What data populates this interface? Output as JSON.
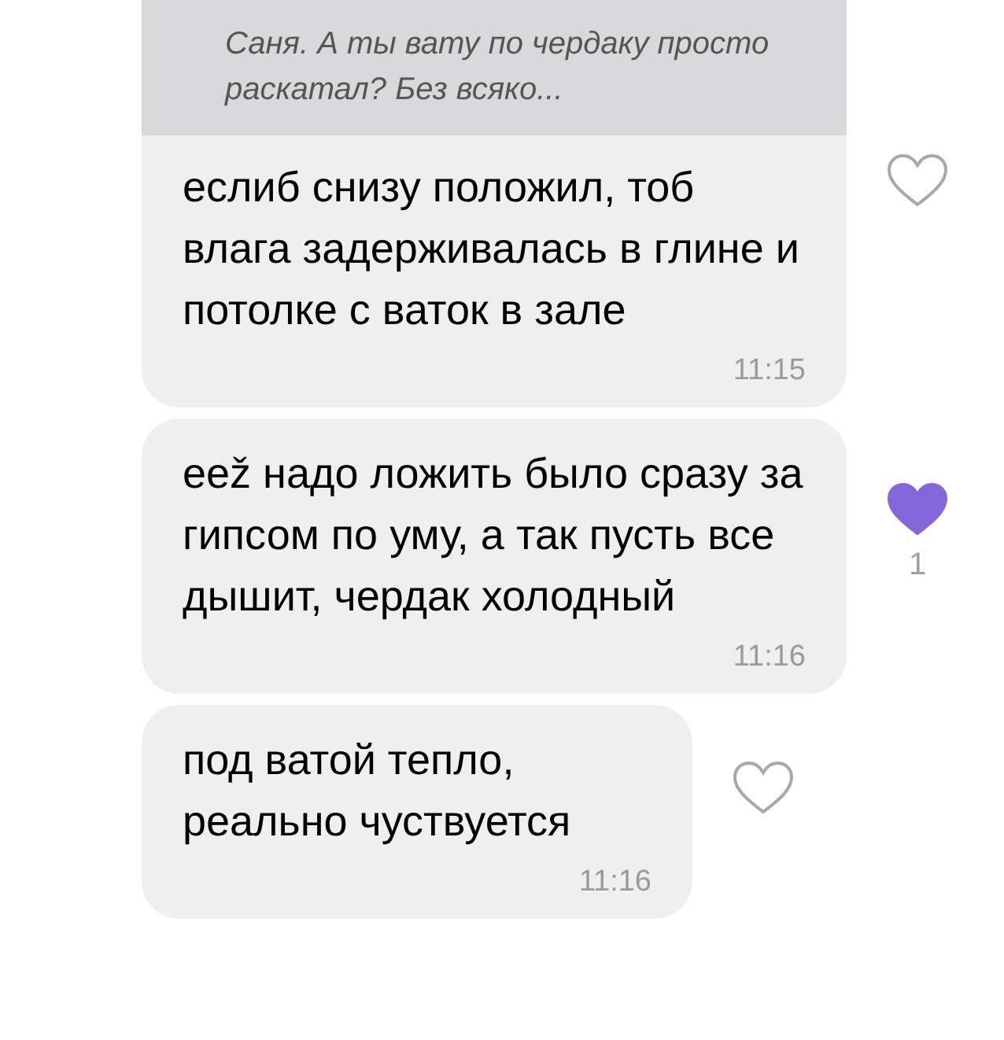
{
  "messages": [
    {
      "quote": "Саня. А ты вату по чердаку просто раскатал? Без всяко...",
      "text": "еслиб снизу положил, тоб влага задерживалась в глине и потолке с ваток в зале",
      "time": "11:15",
      "liked": false
    },
    {
      "text": "еež надо ложить было сразу за гипсом по уму, а так пусть все дышит, чердак холодный",
      "time": "11:16",
      "liked": true,
      "likes": "1"
    },
    {
      "text": "под ватой тепло, реально чуствуется",
      "time": "11:16",
      "liked": false
    }
  ]
}
